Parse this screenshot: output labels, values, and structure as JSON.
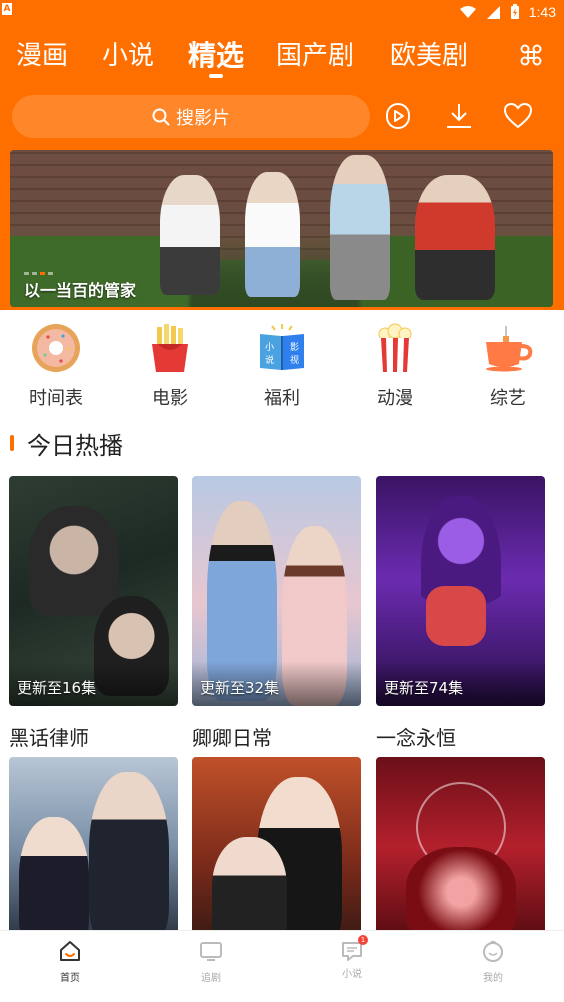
{
  "status_bar": {
    "carrier_icon": "A",
    "time": "1:43"
  },
  "tabs": [
    {
      "label": "漫画",
      "active": false
    },
    {
      "label": "小说",
      "active": false
    },
    {
      "label": "精选",
      "active": true
    },
    {
      "label": "国产剧",
      "active": false
    },
    {
      "label": "欧美剧",
      "active": false
    }
  ],
  "header_icons": {
    "menu": "command-icon",
    "play": "play-icon",
    "download": "download-icon",
    "favorite": "heart-icon"
  },
  "search": {
    "placeholder": "搜影片"
  },
  "banner": {
    "caption": "以一当百的管家",
    "slide_index": 3,
    "slide_count": 4
  },
  "categories": [
    {
      "label": "时间表",
      "icon": "donut-icon"
    },
    {
      "label": "电影",
      "icon": "fries-icon"
    },
    {
      "label": "福利",
      "icon": "book-icon",
      "icon_text": [
        "小",
        "说",
        "影",
        "视"
      ]
    },
    {
      "label": "动漫",
      "icon": "popcorn-icon"
    },
    {
      "label": "综艺",
      "icon": "tea-cup-icon"
    }
  ],
  "section": {
    "title": "今日热播"
  },
  "hot_row1": [
    {
      "title": "黑话律师",
      "badge": "更新至16集"
    },
    {
      "title": "卿卿日常",
      "badge": "更新至32集"
    },
    {
      "title": "一念永恒",
      "badge": "更新至74集"
    }
  ],
  "hot_row2": [
    {
      "title": "",
      "badge": ""
    },
    {
      "title": "",
      "badge": ""
    },
    {
      "title": "",
      "badge": ""
    }
  ],
  "bottom_nav": [
    {
      "label": "首页",
      "icon": "home-icon",
      "active": true
    },
    {
      "label": "追剧",
      "icon": "tv-icon",
      "active": false
    },
    {
      "label": "小说",
      "icon": "message-icon",
      "active": false,
      "badge": "1"
    },
    {
      "label": "我的",
      "icon": "profile-icon",
      "active": false
    }
  ],
  "colors": {
    "accent": "#ff6f00",
    "text": "#222222",
    "muted": "#aaaaaa",
    "badge_red": "#f44336"
  }
}
